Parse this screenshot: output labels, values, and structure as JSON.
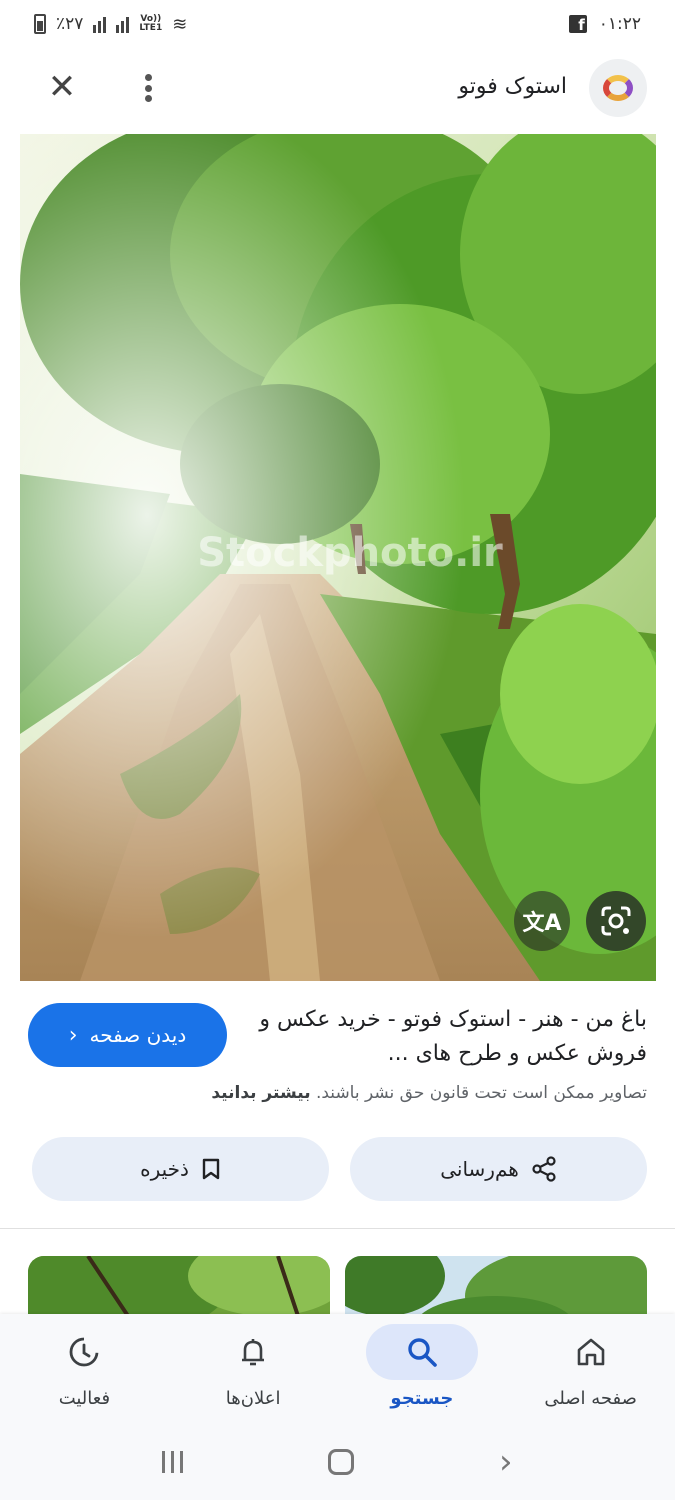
{
  "status_bar": {
    "battery": "٪۲۷",
    "network": "LTE1",
    "volte": "Vo))",
    "time": "۰۱:۲۲"
  },
  "header": {
    "site_name": "استوک فوتو",
    "close_label": "✕"
  },
  "image": {
    "watermark": "Stockphoto.ir"
  },
  "result": {
    "title": "باغ من - هنر - استوک فوتو - خرید عکس و فروش عکس و طرح های ...",
    "visit_label": "دیدن صفحه",
    "copyright_text": "تصاویر ممکن است تحت قانون حق نشر باشند.",
    "learn_more": "بیشتر بدانید"
  },
  "actions": {
    "share_label": "هم‌رسانی",
    "save_label": "ذخیره"
  },
  "bottom_nav": {
    "home": "صفحه اصلی",
    "search": "جستجو",
    "notifications": "اعلان‌ها",
    "activity": "فعالیت"
  },
  "colors": {
    "accent": "#1a73e8",
    "pill_bg": "#e8eef8",
    "nav_active_bg": "#dde6fa"
  },
  "icons": [
    "close-icon",
    "more-vert-icon",
    "google-lens-icon",
    "translate-icon",
    "share-icon",
    "bookmark-icon",
    "home-icon",
    "search-icon",
    "bell-icon",
    "activity-icon"
  ]
}
